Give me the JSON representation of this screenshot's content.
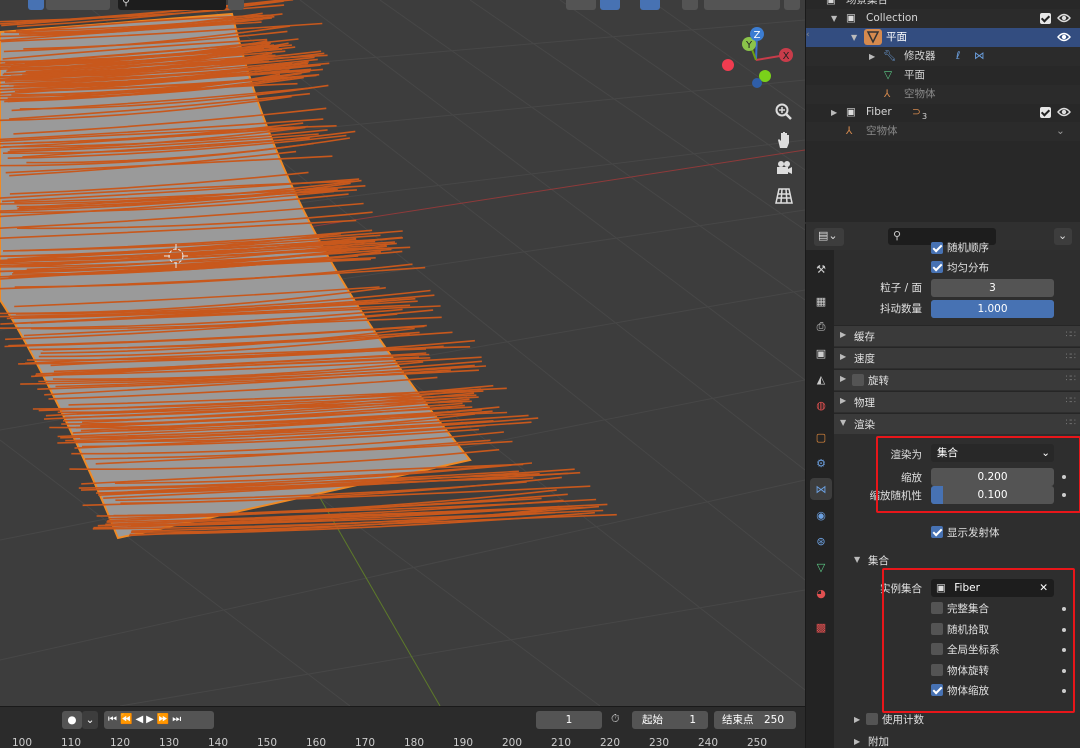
{
  "outliner": {
    "scene_collection": "场景集合",
    "collection": "Collection",
    "plane": "平面",
    "modifiers": "修改器",
    "mesh": "平面",
    "empty_child": "空物体",
    "fiber": "Fiber",
    "fiber_count": "3",
    "empty": "空物体"
  },
  "properties": {
    "cut_top_label": "随机顺序",
    "even_distribution": "均匀分布",
    "particles_per_face_label": "粒子 / 面",
    "particles_per_face": "3",
    "jitter_amount_label": "抖动数量",
    "jitter_amount": "1.000",
    "jitter_fill": 1.0,
    "panels": {
      "cache": "缓存",
      "velocity": "速度",
      "rotation": "旋转",
      "physics": "物理",
      "render": "渲染"
    },
    "render_as_label": "渲染为",
    "render_as": "集合",
    "scale_label": "缩放",
    "scale": "0.200",
    "scale_random_label": "缩放随机性",
    "scale_random": "0.100",
    "scale_random_fill": 0.1,
    "show_emitter": "显示发射体",
    "collection_subpanel": "集合",
    "instance_collection_label": "实例集合",
    "instance_collection": "Fiber",
    "whole_collection": "完整集合",
    "pick_random": "随机拾取",
    "global_coordinates": "全局坐标系",
    "object_rotation": "物体旋转",
    "object_scale": "物体缩放",
    "use_count": "使用计数",
    "extra": "附加"
  },
  "timeline": {
    "current_frame": "1",
    "start_label": "起始",
    "start": "1",
    "end_label": "结束点",
    "end": "250",
    "ticks": [
      "100",
      "110",
      "120",
      "130",
      "140",
      "150",
      "160",
      "170",
      "180",
      "190",
      "200",
      "210",
      "220",
      "230",
      "240",
      "250"
    ]
  },
  "gizmo": {
    "z": "Z",
    "y": "Y",
    "x": "X"
  },
  "colors": {
    "accent": "#4772b3",
    "selection": "#334d80",
    "particles": "#c8581c",
    "object_outline": "#f08a24",
    "highlight": "#e8161a"
  }
}
